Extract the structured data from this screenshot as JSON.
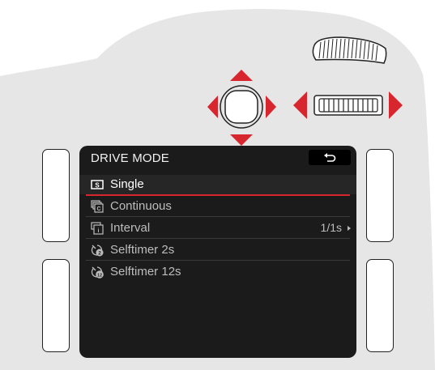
{
  "screen": {
    "title": "DRIVE MODE",
    "back_icon": "return-arrow-icon",
    "accent_color": "#d8262e",
    "items": [
      {
        "label": "Single",
        "icon": "single-frame-icon",
        "value": "",
        "selected": true
      },
      {
        "label": "Continuous",
        "icon": "continuous-icon",
        "value": "",
        "selected": false
      },
      {
        "label": "Interval",
        "icon": "interval-icon",
        "value": "1/1s",
        "selected": false
      },
      {
        "label": "Selftimer 2s",
        "icon": "selftimer-2-icon",
        "value": "",
        "selected": false
      },
      {
        "label": "Selftimer 12s",
        "icon": "selftimer-12-icon",
        "value": "",
        "selected": false
      }
    ]
  },
  "controls": {
    "dpad_arrow_color": "#d8262e",
    "thumbwheel_arrow_color": "#d8262e"
  }
}
